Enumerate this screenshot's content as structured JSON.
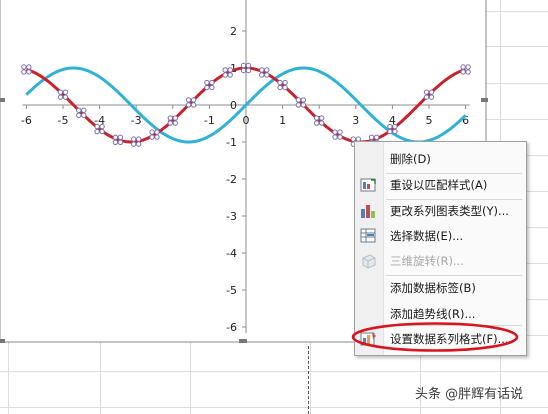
{
  "chart_data": {
    "type": "line",
    "xlim": [
      -6,
      6
    ],
    "ylim": [
      -6,
      2
    ],
    "xticks": [
      -6,
      -5,
      -4,
      -3,
      -2,
      -1,
      0,
      1,
      2,
      3,
      4,
      5,
      6
    ],
    "yticks": [
      2,
      1,
      0,
      -1,
      -2,
      -3,
      -4,
      -5,
      -6
    ],
    "series": [
      {
        "color": "#2fb2d6",
        "function": "sin",
        "x": [
          -6,
          -5.5,
          -5,
          -4.5,
          -4,
          -3.5,
          -3,
          -2.5,
          -2,
          -1.5,
          -1,
          -0.5,
          0,
          0.5,
          1,
          1.5,
          2,
          2.5,
          3,
          3.5,
          4,
          4.5,
          5,
          5.5,
          6
        ],
        "y": [
          0.28,
          0.71,
          0.96,
          0.98,
          0.76,
          0.35,
          -0.14,
          -0.6,
          -0.91,
          -1.0,
          -0.84,
          -0.48,
          0,
          0.48,
          0.84,
          1.0,
          0.91,
          0.6,
          0.14,
          -0.35,
          -0.76,
          -0.98,
          -0.96,
          -0.71,
          -0.28
        ]
      },
      {
        "color": "#c8232c",
        "function": "cos",
        "markers": true,
        "x": [
          -6,
          -5,
          -4.5,
          -4,
          -3.5,
          -3,
          -2.5,
          -2,
          -1.5,
          -1,
          -0.5,
          0,
          0.5,
          1,
          1.5,
          2,
          2.5,
          3,
          3.5,
          4,
          5,
          6
        ],
        "y": [
          0.96,
          0.28,
          -0.21,
          -0.65,
          -0.94,
          -0.99,
          -0.8,
          -0.42,
          0.07,
          0.54,
          0.88,
          1.0,
          0.88,
          0.54,
          0.07,
          -0.42,
          -0.8,
          -0.99,
          -0.94,
          -0.65,
          0.28,
          0.96
        ]
      }
    ]
  },
  "colors": {
    "sin_series": "#2fb2d6",
    "cos_series": "#c8232c",
    "highlight": "#d9141e"
  },
  "context_menu": {
    "items": [
      {
        "label": "删除(D)",
        "icon": "none",
        "enabled": true
      },
      {
        "label": "重设以匹配样式(A)",
        "icon": "reset-style-icon",
        "enabled": true
      },
      {
        "label": "更改系列图表类型(Y)...",
        "icon": "bar-chart-icon",
        "enabled": true
      },
      {
        "label": "选择数据(E)...",
        "icon": "select-data-icon",
        "enabled": true
      },
      {
        "label": "三维旋转(R)...",
        "icon": "3d-rotation-icon",
        "enabled": false
      },
      {
        "label": "添加数据标签(B)",
        "icon": "none",
        "enabled": true
      },
      {
        "label": "添加趋势线(R)...",
        "icon": "none",
        "enabled": true
      },
      {
        "label": "设置数据系列格式(F)...",
        "icon": "format-series-icon",
        "enabled": true,
        "highlighted": true
      }
    ]
  },
  "watermark": "头条 @胖辉有话说"
}
